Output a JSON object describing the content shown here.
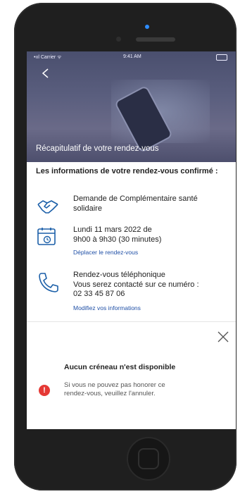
{
  "status_bar": {
    "carrier": "•ııl Carrier ᯤ",
    "time": "9:41 AM"
  },
  "hero": {
    "title": "Récapitulatif de votre rendez-vous"
  },
  "content": {
    "intro": "Les informations de votre rendez-vous confirmé :",
    "request": {
      "line1": "Demande de Complémentaire santé",
      "line2": "solidaire"
    },
    "appointment": {
      "line1": "Lundi 11 mars  2022 de",
      "line2": "9h00 à 9h30 (30 minutes)",
      "link": "Déplacer le rendez-vous"
    },
    "phone": {
      "line1": "Rendez-vous téléphonique",
      "line2": "Vous serez contacté sur ce numéro :",
      "line3": "02 33 45 87 06",
      "link": "Modifiez vos informations"
    }
  },
  "alert": {
    "title": "Aucun créneau n'est disponible",
    "icon_glyph": "!",
    "text_line1": "Si vous ne pouvez pas honorer ce",
    "text_line2": "rendez-vous, veuillez l'annuler."
  },
  "colors": {
    "link": "#1f4fa6",
    "accent_icon": "#1b5fa8",
    "alert": "#e53935"
  }
}
